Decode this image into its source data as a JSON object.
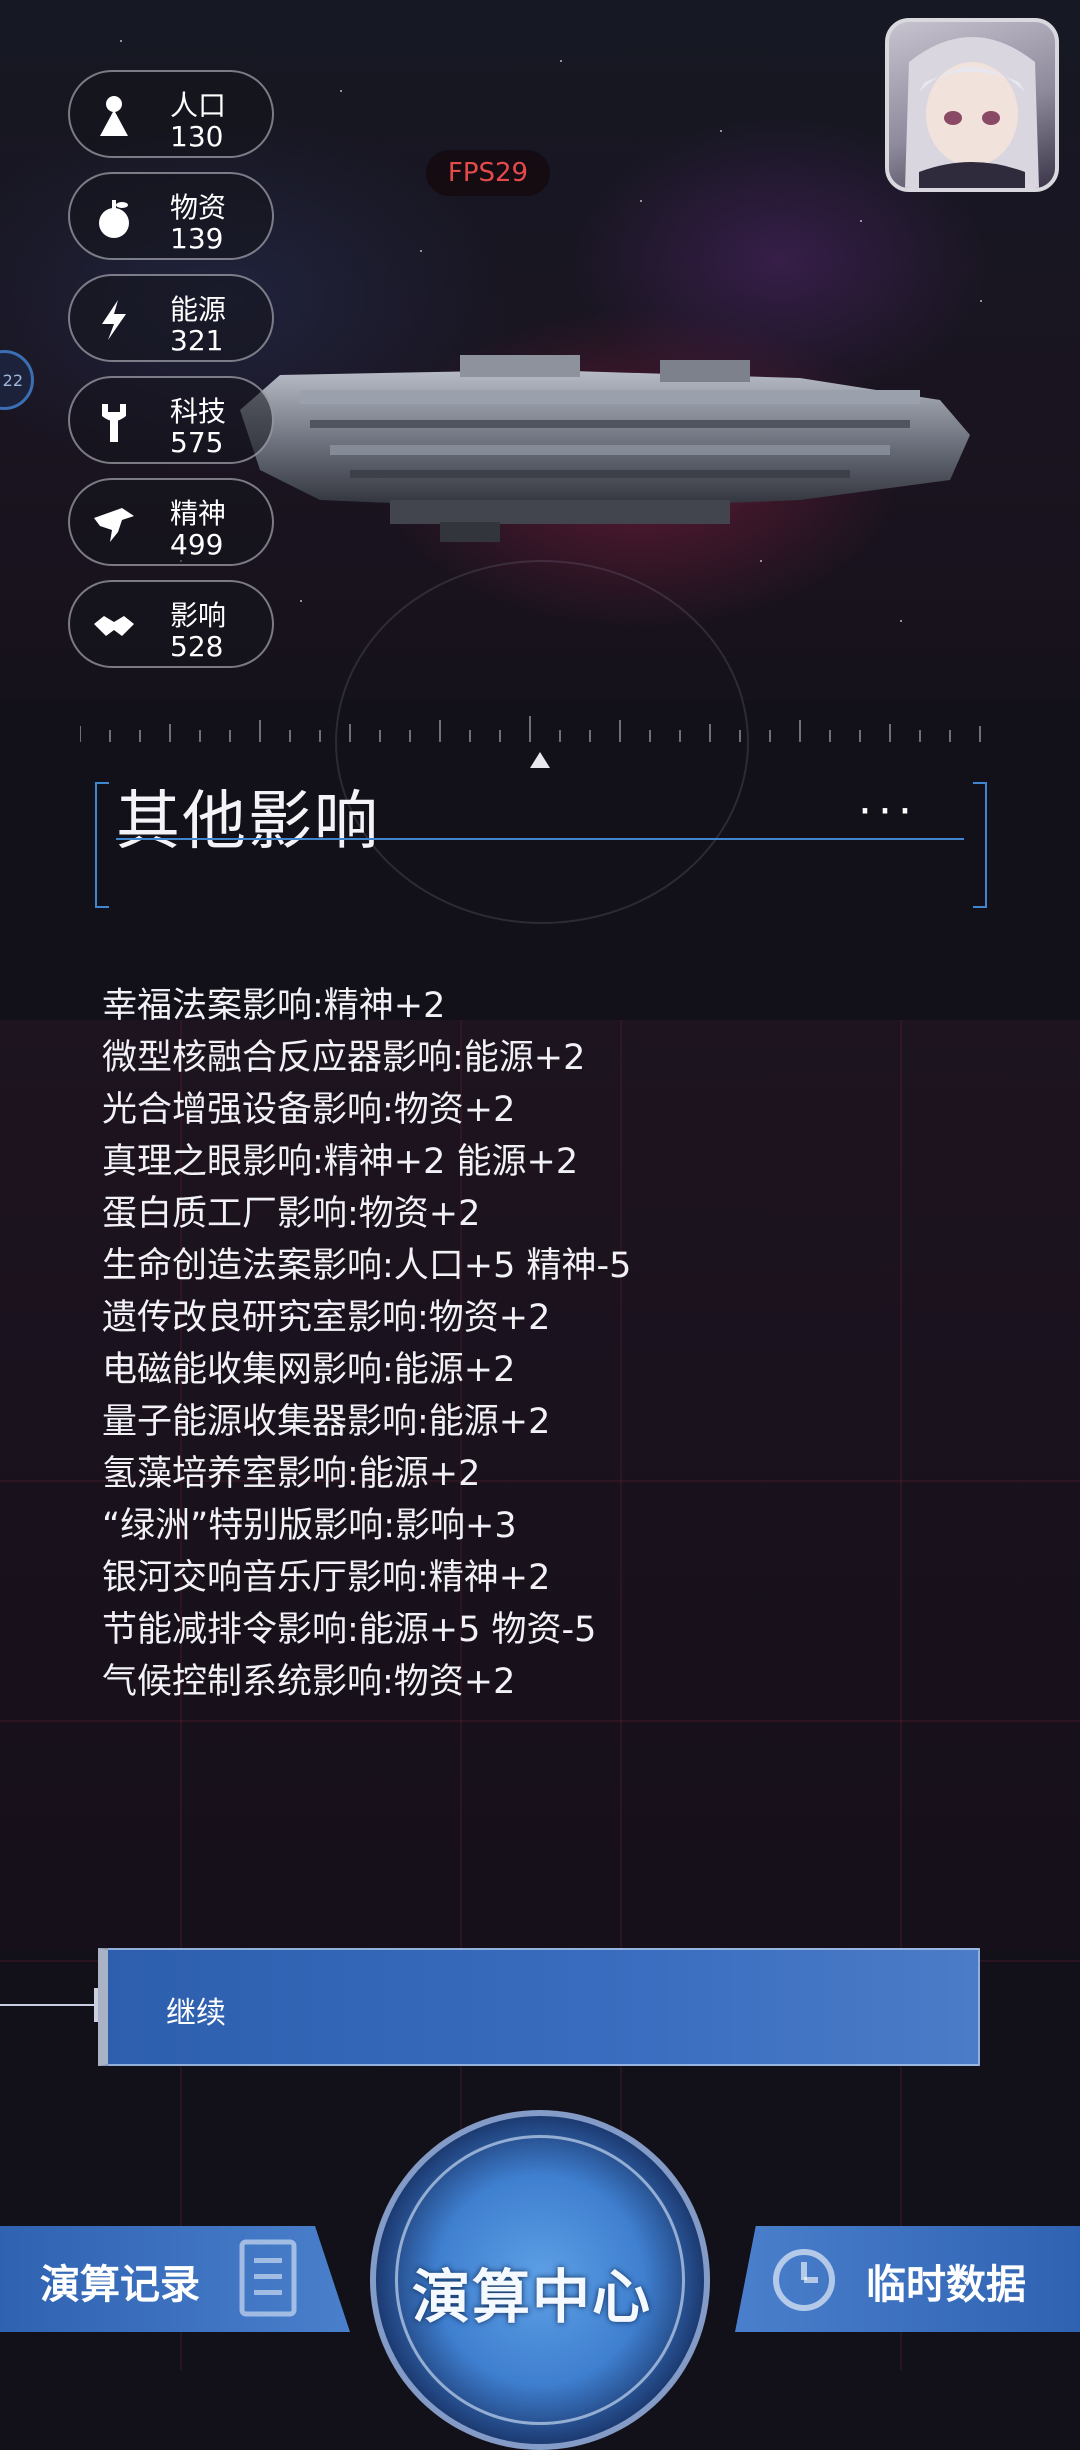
{
  "hud": {
    "fps": "FPS29",
    "side_tab": "22",
    "resources": [
      {
        "name": "人口",
        "value": "130",
        "icon": "person-icon"
      },
      {
        "name": "物资",
        "value": "139",
        "icon": "apple-icon"
      },
      {
        "name": "能源",
        "value": "321",
        "icon": "lightning-icon"
      },
      {
        "name": "科技",
        "value": "575",
        "icon": "wrench-icon"
      },
      {
        "name": "精神",
        "value": "499",
        "icon": "eagle-icon"
      },
      {
        "name": "影响",
        "value": "528",
        "icon": "handshake-icon"
      }
    ]
  },
  "panel": {
    "title": "其他影响",
    "more": "···",
    "effects": [
      "幸福法案影响:精神+2",
      "微型核融合反应器影响:能源+2",
      "光合增强设备影响:物资+2",
      "真理之眼影响:精神+2 能源+2",
      "蛋白质工厂影响:物资+2",
      "生命创造法案影响:人口+5 精神-5",
      "遗传改良研究室影响:物资+2",
      "电磁能收集网影响:能源+2",
      "量子能源收集器影响:能源+2",
      "氢藻培养室影响:能源+2",
      "“绿洲”特别版影响:影响+3",
      "银河交响音乐厅影响:精神+2",
      "节能减排令影响:能源+5 物资-5",
      "气候控制系统影响:物资+2"
    ],
    "continue_label": "继续"
  },
  "nav": {
    "left_label": "演算记录",
    "center_label": "演算中心",
    "right_label": "临时数据"
  },
  "colors": {
    "accent_blue": "#3a6dbf",
    "frame_blue": "#3f86cf",
    "fps_red": "#e44a4a"
  }
}
